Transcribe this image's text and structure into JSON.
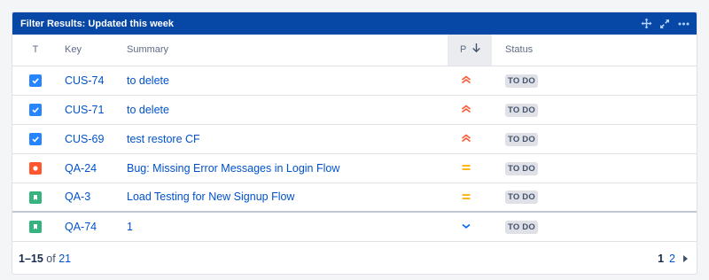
{
  "gadget": {
    "title": "Filter Results: Updated this week"
  },
  "header_icons": [
    "move-icon",
    "expand-icon",
    "more-icon"
  ],
  "columns": {
    "type": "T",
    "key": "Key",
    "summary": "Summary",
    "priority": "P",
    "status": "Status"
  },
  "rows": [
    {
      "type": "task",
      "key": "CUS-74",
      "summary": "to delete",
      "priority": "high",
      "status": "TO DO"
    },
    {
      "type": "task",
      "key": "CUS-71",
      "summary": "to delete",
      "priority": "high",
      "status": "TO DO"
    },
    {
      "type": "task",
      "key": "CUS-69",
      "summary": "test restore CF",
      "priority": "high",
      "status": "TO DO"
    },
    {
      "type": "bug",
      "key": "QA-24",
      "summary": "Bug: Missing Error Messages in Login Flow",
      "priority": "medium",
      "status": "TO DO"
    },
    {
      "type": "story",
      "key": "QA-3",
      "summary": "Load Testing for New Signup Flow",
      "priority": "medium",
      "status": "TO DO"
    },
    {
      "type": "story",
      "key": "QA-74",
      "summary": "1",
      "priority": "low",
      "status": "TO DO"
    }
  ],
  "footer": {
    "range": "1–15",
    "of": "of",
    "total": "21",
    "pages": [
      "1",
      "2"
    ],
    "current_page": "1"
  },
  "colors": {
    "header_bg": "#0747a6",
    "link": "#0052cc",
    "prio_high": "#ff5630",
    "prio_medium": "#ffab00",
    "prio_low": "#0065ff"
  }
}
